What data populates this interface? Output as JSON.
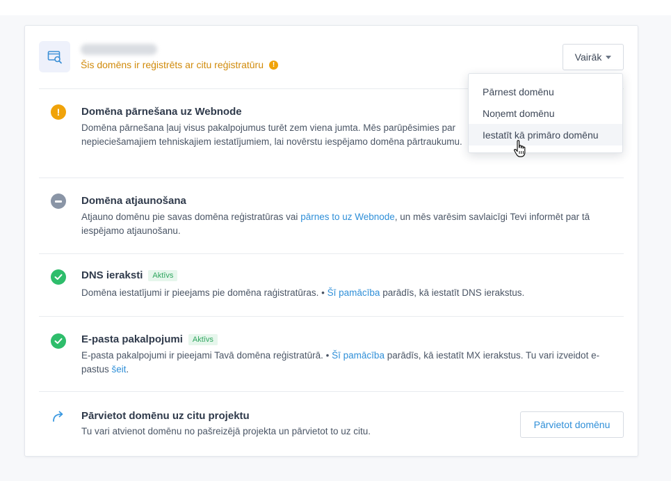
{
  "header": {
    "domain_warning": "Šis domēns ir reģistrēts ar citu reģistratūru",
    "more_button_label": "Vairāk"
  },
  "dropdown": {
    "items": [
      {
        "label": "Pārnest domēnu"
      },
      {
        "label": "Noņemt domēnu"
      },
      {
        "label": "Iestatīt kā primāro domēnu"
      }
    ]
  },
  "sections": {
    "transfer": {
      "title": "Domēna pārnešana uz Webnode",
      "text": "Domēna pārnešana ļauj visus pakalpojumus turēt zem viena jumta. Mēs parūpēsimies par nepieciešamajiem tehniskajiem iestatījumiem, lai novērstu iespējamo domēna pārtraukumu."
    },
    "renewal": {
      "title": "Domēna atjaunošana",
      "text_before": "Atjauno domēnu pie savas domēna reģistratūras vai ",
      "link": "pārnes to uz Webnode",
      "text_after": ", un mēs varēsim savlaicīgi Tevi informēt par tā iespējamo atjaunošanu."
    },
    "dns": {
      "title": "DNS ieraksti",
      "badge": "Aktīvs",
      "text_before": "Domēna iestatījumi ir pieejams pie domēna raģistratūras. • ",
      "link": "Šī pamācība",
      "text_after": " parādīs, kā iestatīt DNS ierakstus."
    },
    "email": {
      "title": "E-pasta pakalpojumi",
      "badge": "Aktīvs",
      "text_before": "E-pasta pakalpojumi ir pieejami Tavā domēna reģistratūrā. • ",
      "link": "Šī pamācība",
      "text_middle": " parādīs, kā iestatīt MX ierakstus. Tu vari izveidot e-pastus ",
      "link2": "šeit",
      "text_after": "."
    },
    "move": {
      "title": "Pārvietot domēnu uz citu projektu",
      "text": "Tu vari atvienot domēnu no pašreizējā projekta un pārvietot to uz citu.",
      "button_label": "Pārvietot domēnu"
    }
  },
  "colors": {
    "accent": "#2f8fd8",
    "warning": "#f0a30a",
    "success": "#2ebd6b",
    "neutral": "#8a95a6"
  }
}
